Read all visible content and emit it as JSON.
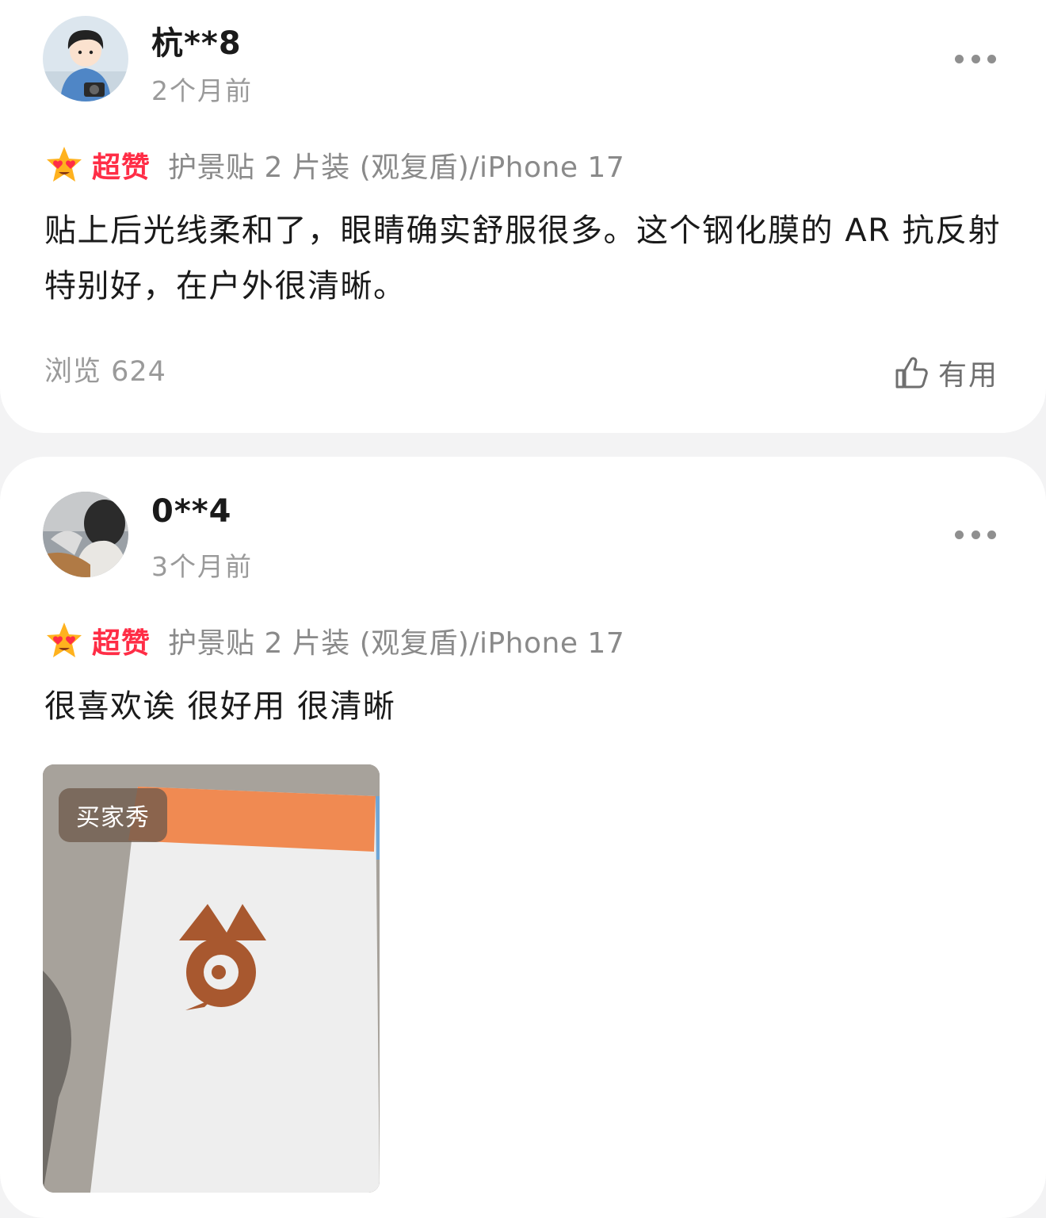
{
  "reviews": [
    {
      "username": "杭**8",
      "time": "2个月前",
      "rating_label": "超赞",
      "rating_icon": "heart-eyes-emoji-icon",
      "sku": "护景贴 2 片装 (观复盾)/iPhone 17",
      "content": "贴上后光线柔和了，眼睛确实舒服很多。这个钢化膜的 AR 抗反射特别好，在户外很清晰。",
      "views": "浏览 624",
      "helpful_label": "有用"
    },
    {
      "username": "0**4",
      "time": "3个月前",
      "rating_label": "超赞",
      "rating_icon": "heart-eyes-emoji-icon",
      "sku": "护景贴 2 片装 (观复盾)/iPhone 17",
      "content": "很喜欢诶 很好用 很清晰",
      "photo_badge": "买家秀"
    }
  ],
  "colors": {
    "rating_red": "#ff2d46",
    "muted_text": "#9a9a9a",
    "page_background": "#f3f3f4"
  }
}
